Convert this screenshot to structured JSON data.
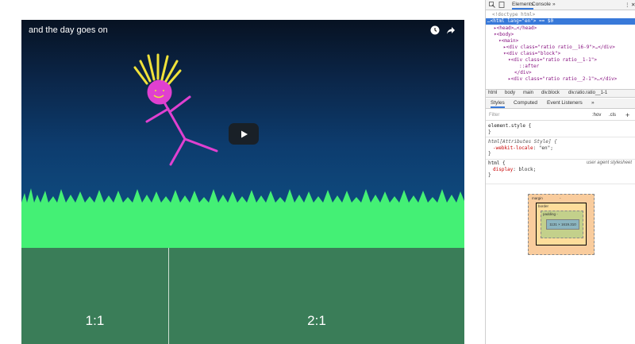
{
  "video": {
    "title": "and the day goes on"
  },
  "blocks": [
    {
      "label": "1:1"
    },
    {
      "label": "2:1"
    }
  ],
  "devtools": {
    "tabs": {
      "elements": "Elements",
      "console": "Console",
      "more": "»"
    },
    "dom_lines": [
      "<!doctype html>",
      "…<html lang=\"en\"> == $0",
      "▸<head>…</head>",
      "▾<body>",
      "▾<main>",
      "▸<div class=\"ratio ratio__16-9\">…</div>",
      "▾<div class=\"block\">",
      "▾<div class=\"ratio ratio__1-1\">",
      "::after",
      "</div>",
      "▸<div class=\"ratio ratio__2-1\">…</div>"
    ],
    "breadcrumbs": [
      "html",
      "body",
      "main",
      "div.block",
      "div.ratio.ratio__1-1"
    ],
    "subtabs": [
      "Styles",
      "Computed",
      "Event Listeners",
      "»"
    ],
    "filter_placeholder": "Filter",
    "hov": ":hov",
    "cls": ".cls",
    "plus": "+",
    "rules": {
      "element_style": "element.style {",
      "close": "}",
      "attr_selector": "html[Attributes Style] {",
      "attr_prop": "-webkit-locale",
      "attr_val": "\"en\";",
      "html_selector": "html {",
      "html_source": "user agent stylesheet",
      "html_prop": "display",
      "html_val": "block;"
    },
    "box_model": {
      "margin": "margin",
      "border": "border",
      "padding": "padding -",
      "content": "1131 × 1619.310",
      "dash": "-"
    }
  }
}
